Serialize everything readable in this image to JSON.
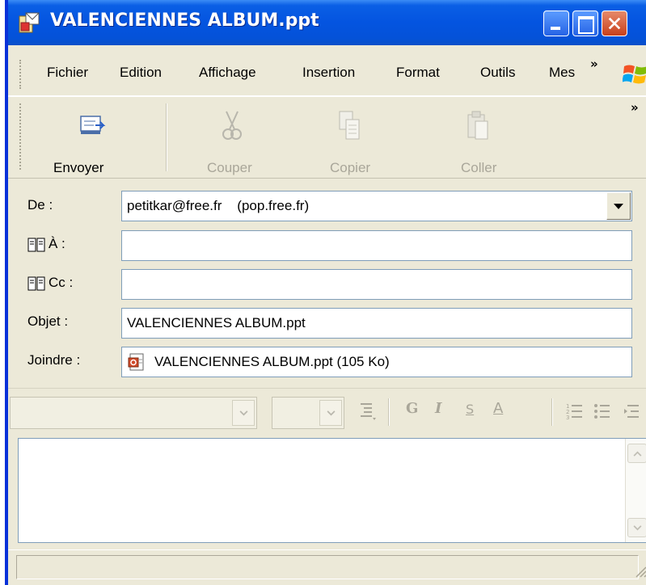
{
  "window": {
    "title": "VALENCIENNES ALBUM.ppt"
  },
  "menu": {
    "items": [
      "Fichier",
      "Edition",
      "Affichage",
      "Insertion",
      "Format",
      "Outils",
      "Mes"
    ],
    "more": "»"
  },
  "toolbar": {
    "send_label": "Envoyer",
    "cut_label": "Couper",
    "copy_label": "Copier",
    "paste_label": "Coller",
    "more": "»"
  },
  "header": {
    "from_label": "De :",
    "from_value": "petitkar@free.fr    (pop.free.fr)",
    "to_label": "À :",
    "to_value": "",
    "cc_label": "Cc :",
    "cc_value": "",
    "subject_label": "Objet :",
    "subject_value": "VALENCIENNES ALBUM.ppt",
    "attach_label": "Joindre :",
    "attachment": "VALENCIENNES ALBUM.ppt (105 Ko)"
  },
  "format_bar": {
    "bold": "G",
    "italic": "I",
    "underline": "S",
    "font_color": "A"
  },
  "colors": {
    "title_bar": "#0454e0",
    "window_bg": "#ece9d8",
    "close_button": "#c8401c"
  }
}
